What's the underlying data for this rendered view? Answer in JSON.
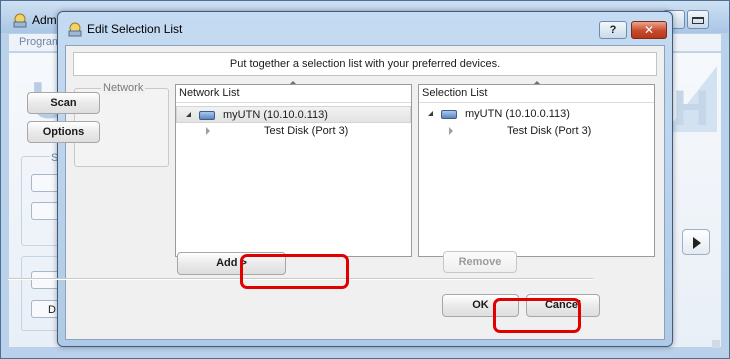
{
  "background_window": {
    "title": "Adm",
    "menu_item": "Program",
    "logo_left": "U",
    "logo_right": "H",
    "stub_label": "D",
    "group_label": "S"
  },
  "dialog": {
    "title": "Edit Selection List",
    "help_label": "?",
    "close_label": "✕",
    "instruction": "Put together a selection list with your preferred devices.",
    "network_group": {
      "label": "Network",
      "scan_label": "Scan",
      "options_label": "Options"
    },
    "network_list": {
      "header": "Network List",
      "items": [
        {
          "label": "myUTN (10.10.0.113)",
          "expanded": true,
          "selected": true
        },
        {
          "label": "Test Disk (Port 3)",
          "child": true
        }
      ]
    },
    "selection_list": {
      "header": "Selection List",
      "items": [
        {
          "label": "myUTN (10.10.0.113)",
          "expanded": true
        },
        {
          "label": "Test Disk (Port 3)",
          "child": true
        }
      ]
    },
    "add_label": "Add >",
    "remove_label": "Remove",
    "ok_label": "OK",
    "cancel_label": "Cancel"
  },
  "annotation_color": "#e00000"
}
